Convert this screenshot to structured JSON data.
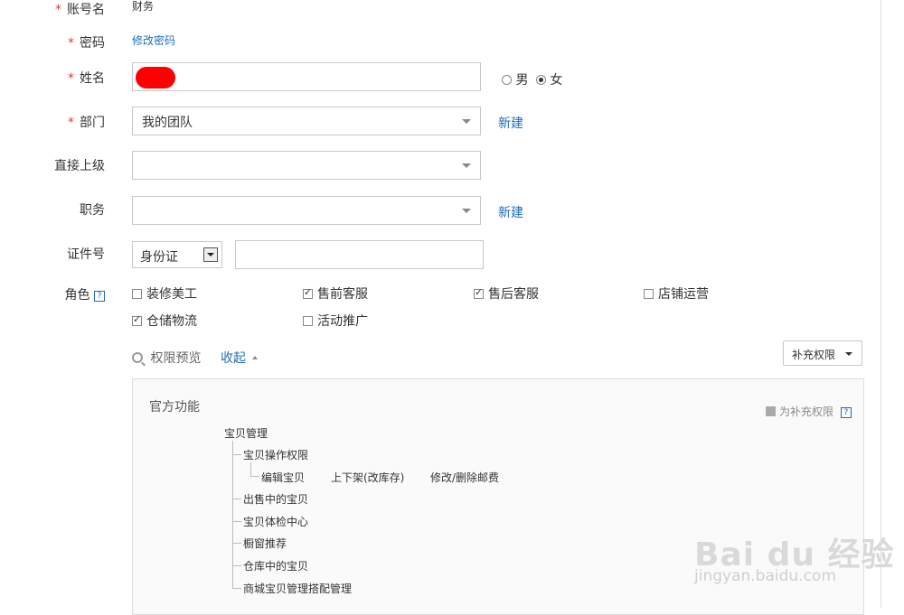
{
  "form": {
    "account_label": "账号名",
    "account_value": "财务",
    "password_label": "密码",
    "password_link": "修改密码",
    "name_label": "姓名",
    "gender_male": "男",
    "gender_female": "女",
    "dept_label": "部门",
    "dept_value": "我的团队",
    "dept_new": "新建",
    "superior_label": "直接上级",
    "position_label": "职务",
    "position_new": "新建",
    "id_label": "证件号",
    "id_type": "身份证",
    "role_label": "角色"
  },
  "roles": [
    {
      "label": "装修美工",
      "checked": false
    },
    {
      "label": "售前客服",
      "checked": true
    },
    {
      "label": "售后客服",
      "checked": true
    },
    {
      "label": "店铺运营",
      "checked": false
    },
    {
      "label": "仓储物流",
      "checked": true
    },
    {
      "label": "活动推广",
      "checked": false
    }
  ],
  "permissions": {
    "preview_label": "权限预览",
    "collapse_label": "收起",
    "supplement_button": "补充权限",
    "section_title": "官方功能",
    "supplement_legend": "为补充权限",
    "tree": {
      "root": "宝贝管理",
      "l1_0": "宝贝操作权限",
      "l2_0": "编辑宝贝",
      "l2_1": "上下架(改库存)",
      "l2_2": "修改/删除邮费",
      "l1_1": "出售中的宝贝",
      "l1_2": "宝贝体检中心",
      "l1_3": "橱窗推荐",
      "l1_4": "仓库中的宝贝",
      "l1_5": "商城宝贝管理搭配管理"
    }
  },
  "watermark": {
    "brand": "Bai du 经验",
    "url": "jingyan.baidu.com"
  },
  "colors": {
    "required": "#e4393c",
    "link": "#1e6db5",
    "redaction": "#ff0000"
  }
}
